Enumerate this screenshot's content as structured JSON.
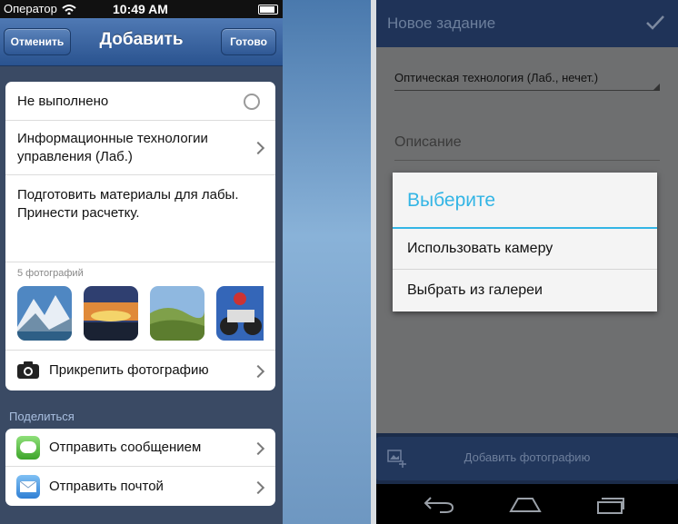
{
  "ios": {
    "status": {
      "carrier": "Оператор",
      "time": "10:49 AM"
    },
    "nav": {
      "cancel": "Отменить",
      "title": "Добавить",
      "done": "Готово"
    },
    "status_row": "Не выполнено",
    "subject": "Информационные технологии управления (Лаб.)",
    "note": "Подготовить материалы для лабы. Принести расчетку.",
    "photos_count": "5 фотографий",
    "attach_photo": "Прикрепить фотографию",
    "share_header": "Поделиться",
    "share_items": [
      {
        "label": "Отправить сообщением",
        "icon": "message-icon"
      },
      {
        "label": "Отправить почтой",
        "icon": "mail-icon"
      }
    ],
    "colors": {
      "accent": "#3c66a5",
      "background": "#3a4a64"
    }
  },
  "android": {
    "action_bar": {
      "title": "Новое задание",
      "confirm_icon": "check-icon"
    },
    "subject_spinner": "Оптическая технология (Лаб., нечет.)",
    "description_hint": "Описание",
    "dialog": {
      "title": "Выберите",
      "options": [
        "Использовать камеру",
        "Выбрать из галереи"
      ]
    },
    "add_photo_button": "Добавить фотографию",
    "colors": {
      "holo_blue": "#33b5e5",
      "action_bar": "#1f3358"
    }
  }
}
